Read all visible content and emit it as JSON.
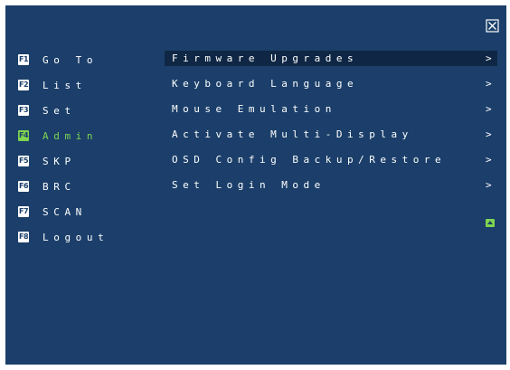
{
  "icons": {
    "close": "close-icon",
    "scroll_up": "scroll-up-icon"
  },
  "colors": {
    "background": "#1b3f6a",
    "text": "#ffffff",
    "active": "#7fd450",
    "selection": "#0f2745"
  },
  "sidebar": {
    "items": [
      {
        "key": "F1",
        "label": "Go To"
      },
      {
        "key": "F2",
        "label": "List"
      },
      {
        "key": "F3",
        "label": "Set"
      },
      {
        "key": "F4",
        "label": "Admin",
        "active": true
      },
      {
        "key": "F5",
        "label": "SKP"
      },
      {
        "key": "F6",
        "label": "BRC"
      },
      {
        "key": "F7",
        "label": "SCAN"
      },
      {
        "key": "F8",
        "label": "Logout"
      }
    ]
  },
  "admin_menu": {
    "options": [
      {
        "label": "Firmware Upgrades",
        "arrow": ">",
        "selected": true
      },
      {
        "label": "Keyboard Language",
        "arrow": ">"
      },
      {
        "label": "Mouse Emulation",
        "arrow": ">"
      },
      {
        "label": "Activate Multi-Display",
        "arrow": ">"
      },
      {
        "label": "OSD Config Backup/Restore",
        "arrow": ">"
      },
      {
        "label": "Set Login Mode",
        "arrow": ">"
      }
    ]
  }
}
